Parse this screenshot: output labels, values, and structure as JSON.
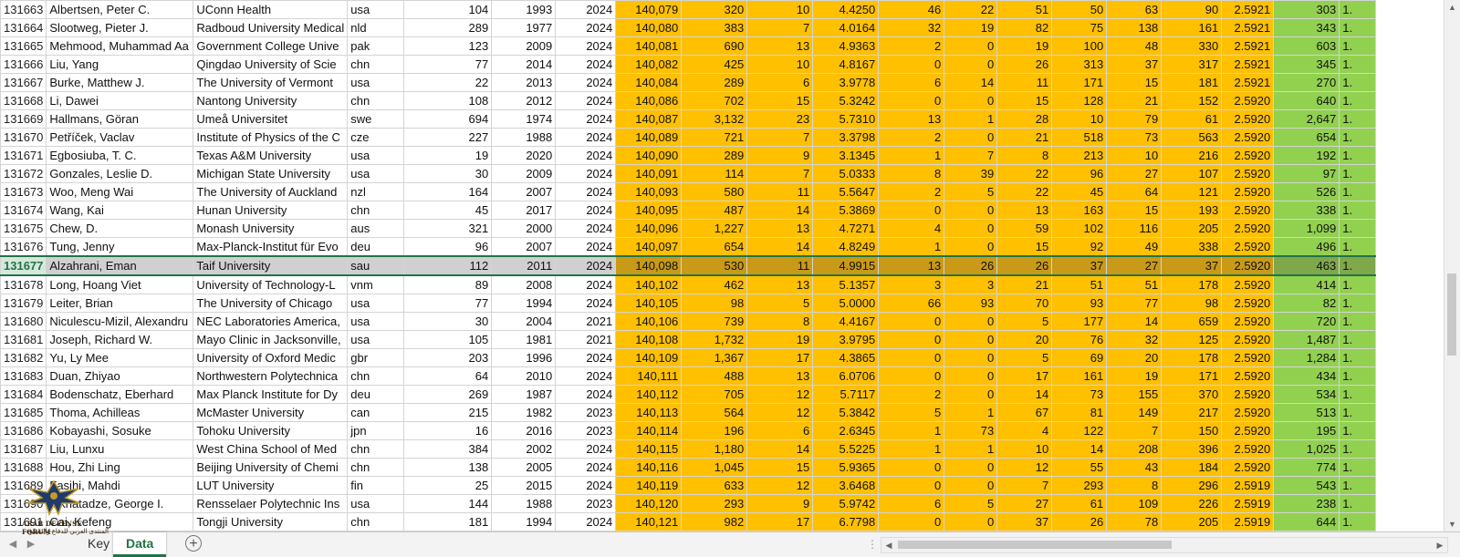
{
  "sheet": {
    "columns": [
      {
        "key": "row",
        "width": 50,
        "align": "left",
        "style": "rn"
      },
      {
        "key": "name",
        "width": 161,
        "align": "left"
      },
      {
        "key": "institution",
        "width": 161,
        "align": "left"
      },
      {
        "key": "country",
        "width": 62,
        "align": "left"
      },
      {
        "key": "c1",
        "width": 96,
        "align": "right"
      },
      {
        "key": "c2",
        "width": 70,
        "align": "right"
      },
      {
        "key": "c3",
        "width": 66,
        "align": "right"
      },
      {
        "key": "c4",
        "width": 72,
        "align": "right",
        "style": "or"
      },
      {
        "key": "c5",
        "width": 72,
        "align": "right",
        "style": "or"
      },
      {
        "key": "c6",
        "width": 72,
        "align": "right",
        "style": "or"
      },
      {
        "key": "c7",
        "width": 72,
        "align": "right",
        "style": "or"
      },
      {
        "key": "c8",
        "width": 72,
        "align": "right",
        "style": "or"
      },
      {
        "key": "c9",
        "width": 58,
        "align": "right",
        "style": "or"
      },
      {
        "key": "c10",
        "width": 60,
        "align": "right",
        "style": "or"
      },
      {
        "key": "c11",
        "width": 60,
        "align": "right",
        "style": "or"
      },
      {
        "key": "c12",
        "width": 60,
        "align": "right",
        "style": "or"
      },
      {
        "key": "c13",
        "width": 66,
        "align": "right",
        "style": "or"
      },
      {
        "key": "c14",
        "width": 57,
        "align": "right",
        "style": "or"
      },
      {
        "key": "c15",
        "width": 72,
        "align": "right",
        "style": "gr"
      },
      {
        "key": "c16",
        "width": 40,
        "align": "left",
        "style": "gr"
      }
    ],
    "selected_row": "131677",
    "rows": [
      [
        "131663",
        "Albertsen, Peter C.",
        "UConn Health",
        "usa",
        "104",
        "1993",
        "2024",
        "140,079",
        "320",
        "10",
        "4.4250",
        "46",
        "22",
        "51",
        "50",
        "63",
        "90",
        "2.5921",
        "303",
        "1."
      ],
      [
        "131664",
        "Slootweg, Pieter J.",
        "Radboud University Medical",
        "nld",
        "289",
        "1977",
        "2024",
        "140,080",
        "383",
        "7",
        "4.0164",
        "32",
        "19",
        "82",
        "75",
        "138",
        "161",
        "2.5921",
        "343",
        "1."
      ],
      [
        "131665",
        "Mehmood, Muhammad Aa",
        "Government College Unive",
        "pak",
        "123",
        "2009",
        "2024",
        "140,081",
        "690",
        "13",
        "4.9363",
        "2",
        "0",
        "19",
        "100",
        "48",
        "330",
        "2.5921",
        "603",
        "1."
      ],
      [
        "131666",
        "Liu, Yang",
        "Qingdao University of Scie",
        "chn",
        "77",
        "2014",
        "2024",
        "140,082",
        "425",
        "10",
        "4.8167",
        "0",
        "0",
        "26",
        "313",
        "37",
        "317",
        "2.5921",
        "345",
        "1."
      ],
      [
        "131667",
        "Burke, Matthew J.",
        "The University of Vermont",
        "usa",
        "22",
        "2013",
        "2024",
        "140,084",
        "289",
        "6",
        "3.9778",
        "6",
        "14",
        "11",
        "171",
        "15",
        "181",
        "2.5921",
        "270",
        "1."
      ],
      [
        "131668",
        "Li, Dawei",
        "Nantong University",
        "chn",
        "108",
        "2012",
        "2024",
        "140,086",
        "702",
        "15",
        "5.3242",
        "0",
        "0",
        "15",
        "128",
        "21",
        "152",
        "2.5920",
        "640",
        "1."
      ],
      [
        "131669",
        "Hallmans, Göran",
        "Umeå Universitet",
        "swe",
        "694",
        "1974",
        "2024",
        "140,087",
        "3,132",
        "23",
        "5.7310",
        "13",
        "1",
        "28",
        "10",
        "79",
        "61",
        "2.5920",
        "2,647",
        "1."
      ],
      [
        "131670",
        "Petříček, Vaclav",
        "Institute of Physics of the C",
        "cze",
        "227",
        "1988",
        "2024",
        "140,089",
        "721",
        "7",
        "3.3798",
        "2",
        "0",
        "21",
        "518",
        "73",
        "563",
        "2.5920",
        "654",
        "1."
      ],
      [
        "131671",
        "Egbosiuba, T. C.",
        "Texas A&M University",
        "usa",
        "19",
        "2020",
        "2024",
        "140,090",
        "289",
        "9",
        "3.1345",
        "1",
        "7",
        "8",
        "213",
        "10",
        "216",
        "2.5920",
        "192",
        "1."
      ],
      [
        "131672",
        "Gonzales, Leslie D.",
        "Michigan State University",
        "usa",
        "30",
        "2009",
        "2024",
        "140,091",
        "114",
        "7",
        "5.0333",
        "8",
        "39",
        "22",
        "96",
        "27",
        "107",
        "2.5920",
        "97",
        "1."
      ],
      [
        "131673",
        "Woo, Meng Wai",
        "The University of Auckland",
        "nzl",
        "164",
        "2007",
        "2024",
        "140,093",
        "580",
        "11",
        "5.5647",
        "2",
        "5",
        "22",
        "45",
        "64",
        "121",
        "2.5920",
        "526",
        "1."
      ],
      [
        "131674",
        "Wang, Kai",
        "Hunan University",
        "chn",
        "45",
        "2017",
        "2024",
        "140,095",
        "487",
        "14",
        "5.3869",
        "0",
        "0",
        "13",
        "163",
        "15",
        "193",
        "2.5920",
        "338",
        "1."
      ],
      [
        "131675",
        "Chew, D.",
        "Monash University",
        "aus",
        "321",
        "2000",
        "2024",
        "140,096",
        "1,227",
        "13",
        "4.7271",
        "4",
        "0",
        "59",
        "102",
        "116",
        "205",
        "2.5920",
        "1,099",
        "1."
      ],
      [
        "131676",
        "Tung, Jenny",
        "Max-Planck-Institut für Evo",
        "deu",
        "96",
        "2007",
        "2024",
        "140,097",
        "654",
        "14",
        "4.8249",
        "1",
        "0",
        "15",
        "92",
        "49",
        "338",
        "2.5920",
        "496",
        "1."
      ],
      [
        "131677",
        "Alzahrani, Eman",
        "Taif University",
        "sau",
        "112",
        "2011",
        "2024",
        "140,098",
        "530",
        "11",
        "4.9915",
        "13",
        "26",
        "26",
        "37",
        "27",
        "37",
        "2.5920",
        "463",
        "1."
      ],
      [
        "131678",
        "Long, Hoang Viet",
        "University of Technology-L",
        "vnm",
        "89",
        "2008",
        "2024",
        "140,102",
        "462",
        "13",
        "5.1357",
        "3",
        "3",
        "21",
        "51",
        "51",
        "178",
        "2.5920",
        "414",
        "1."
      ],
      [
        "131679",
        "Leiter, Brian",
        "The University of Chicago",
        "usa",
        "77",
        "1994",
        "2024",
        "140,105",
        "98",
        "5",
        "5.0000",
        "66",
        "93",
        "70",
        "93",
        "77",
        "98",
        "2.5920",
        "82",
        "1."
      ],
      [
        "131680",
        "Niculescu-Mizil, Alexandru",
        "NEC Laboratories America,",
        "usa",
        "30",
        "2004",
        "2021",
        "140,106",
        "739",
        "8",
        "4.4167",
        "0",
        "0",
        "5",
        "177",
        "14",
        "659",
        "2.5920",
        "720",
        "1."
      ],
      [
        "131681",
        "Joseph, Richard W.",
        "Mayo Clinic in Jacksonville,",
        "usa",
        "105",
        "1981",
        "2021",
        "140,108",
        "1,732",
        "19",
        "3.9795",
        "0",
        "0",
        "20",
        "76",
        "32",
        "125",
        "2.5920",
        "1,487",
        "1."
      ],
      [
        "131682",
        "Yu, Ly Mee",
        "University of Oxford Medic",
        "gbr",
        "203",
        "1996",
        "2024",
        "140,109",
        "1,367",
        "17",
        "4.3865",
        "0",
        "0",
        "5",
        "69",
        "20",
        "178",
        "2.5920",
        "1,284",
        "1."
      ],
      [
        "131683",
        "Duan, Zhiyao",
        "Northwestern Polytechnica",
        "chn",
        "64",
        "2010",
        "2024",
        "140,111",
        "488",
        "13",
        "6.0706",
        "0",
        "0",
        "17",
        "161",
        "19",
        "171",
        "2.5920",
        "434",
        "1."
      ],
      [
        "131684",
        "Bodenschatz, Eberhard",
        "Max Planck Institute for Dy",
        "deu",
        "269",
        "1987",
        "2024",
        "140,112",
        "705",
        "12",
        "5.7117",
        "2",
        "0",
        "14",
        "73",
        "155",
        "370",
        "2.5920",
        "534",
        "1."
      ],
      [
        "131685",
        "Thoma, Achilleas",
        "McMaster University",
        "can",
        "215",
        "1982",
        "2023",
        "140,113",
        "564",
        "12",
        "5.3842",
        "5",
        "1",
        "67",
        "81",
        "149",
        "217",
        "2.5920",
        "513",
        "1."
      ],
      [
        "131686",
        "Kobayashi, Sosuke",
        "Tohoku University",
        "jpn",
        "16",
        "2016",
        "2023",
        "140,114",
        "196",
        "6",
        "2.6345",
        "1",
        "73",
        "4",
        "122",
        "7",
        "150",
        "2.5920",
        "195",
        "1."
      ],
      [
        "131687",
        "Liu, Lunxu",
        "West China School of Med",
        "chn",
        "384",
        "2002",
        "2024",
        "140,115",
        "1,180",
        "14",
        "5.5225",
        "1",
        "1",
        "10",
        "14",
        "208",
        "396",
        "2.5920",
        "1,025",
        "1."
      ],
      [
        "131688",
        "Hou, Zhi Ling",
        "Beijing University of Chemi",
        "chn",
        "138",
        "2005",
        "2024",
        "140,116",
        "1,045",
        "15",
        "5.9365",
        "0",
        "0",
        "12",
        "55",
        "43",
        "184",
        "2.5920",
        "774",
        "1."
      ],
      [
        "131689",
        "Fasihi, Mahdi",
        "LUT University",
        "fin",
        "25",
        "2015",
        "2024",
        "140,119",
        "633",
        "12",
        "3.6468",
        "0",
        "0",
        "7",
        "293",
        "8",
        "296",
        "2.5919",
        "543",
        "1."
      ],
      [
        "131690",
        "Mkhatadze, George I.",
        "Rensselaer Polytechnic Ins",
        "usa",
        "144",
        "1988",
        "2023",
        "140,120",
        "293",
        "9",
        "5.9742",
        "6",
        "5",
        "27",
        "61",
        "109",
        "226",
        "2.5919",
        "238",
        "1."
      ],
      [
        "131691",
        "Cai, Kefeng",
        "Tongji University",
        "chn",
        "181",
        "1994",
        "2024",
        "140,121",
        "982",
        "17",
        "6.7798",
        "0",
        "0",
        "37",
        "26",
        "78",
        "205",
        "2.5919",
        "644",
        "1."
      ]
    ]
  },
  "tabs": {
    "key_label": "Key",
    "data_label": "Data",
    "active": "Data"
  },
  "watermark": {
    "title": "ARAB DEFENSE FORUM",
    "subtitle": "المنتدى العربي للدفاع والتسليح"
  },
  "colors": {
    "orange_fill": "#ffc000",
    "green_fill": "#92d050",
    "accent": "#217346"
  }
}
